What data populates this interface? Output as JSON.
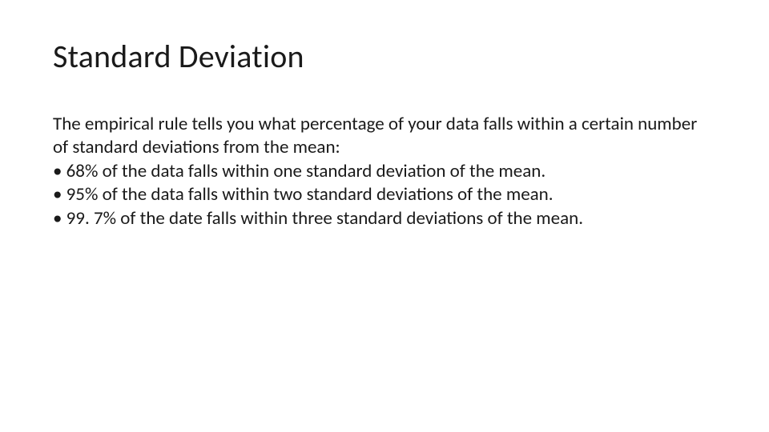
{
  "title": "Standard Deviation",
  "intro": "The empirical rule tells you what percentage of your data falls within a certain number of standard deviations from the mean:",
  "bullets": [
    "• 68% of the data falls within one standard deviation of the mean.",
    "• 95% of the data falls within two standard deviations of the mean.",
    "• 99. 7% of the date falls within three standard deviations of the mean."
  ]
}
